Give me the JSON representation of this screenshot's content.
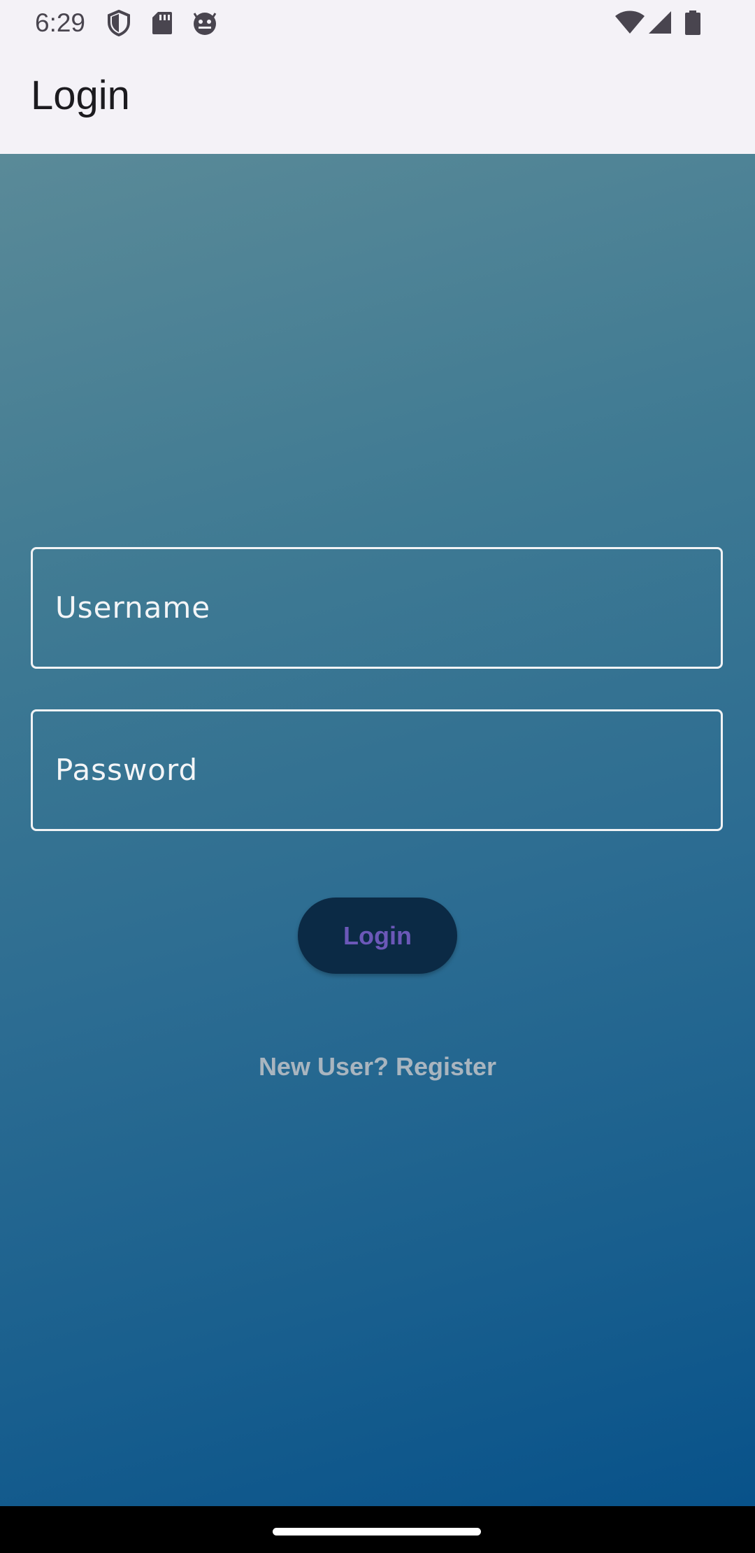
{
  "status_bar": {
    "time": "6:29",
    "left_icons": [
      "shield-icon",
      "sd-card-icon",
      "android-face-icon"
    ],
    "right_icons": [
      "wifi-icon",
      "signal-icon",
      "battery-icon"
    ]
  },
  "app_bar": {
    "title": "Login"
  },
  "form": {
    "username": {
      "placeholder": "Username",
      "value": ""
    },
    "password": {
      "placeholder": "Password",
      "value": ""
    },
    "login_button": "Login",
    "register_link": "New User? Register"
  },
  "colors": {
    "background_top": "#5a8a98",
    "background_bottom": "#08528a",
    "button_bg": "#0b2a45",
    "button_text": "#6b58b8",
    "link_text": "#a9b5bf"
  }
}
